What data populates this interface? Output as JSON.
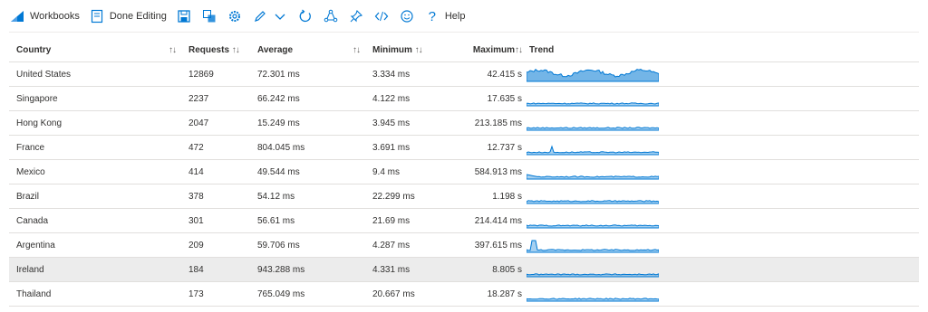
{
  "toolbar": {
    "workbooks_label": "Workbooks",
    "done_editing_label": "Done Editing",
    "help_label": "Help",
    "icons": [
      "save-icon",
      "clone-icon",
      "settings-icon",
      "edit-icon",
      "chevron-down-icon",
      "refresh-icon",
      "share-icon",
      "pin-icon",
      "code-icon",
      "smiley-icon",
      "help-icon"
    ],
    "accent": "#0078d4"
  },
  "table": {
    "columns": [
      "Country",
      "Requests",
      "Average",
      "Minimum",
      "Maximum",
      "Trend"
    ],
    "sort_glyph": "↑↓",
    "rows": [
      {
        "country": "United States",
        "requests": "12869",
        "average": "72.301 ms",
        "minimum": "3.334 ms",
        "maximum": "42.415 s"
      },
      {
        "country": "Singapore",
        "requests": "2237",
        "average": "66.242 ms",
        "minimum": "4.122 ms",
        "maximum": "17.635 s"
      },
      {
        "country": "Hong Kong",
        "requests": "2047",
        "average": "15.249 ms",
        "minimum": "3.945 ms",
        "maximum": "213.185 ms"
      },
      {
        "country": "France",
        "requests": "472",
        "average": "804.045 ms",
        "minimum": "3.691 ms",
        "maximum": "12.737 s"
      },
      {
        "country": "Mexico",
        "requests": "414",
        "average": "49.544 ms",
        "minimum": "9.4 ms",
        "maximum": "584.913 ms"
      },
      {
        "country": "Brazil",
        "requests": "378",
        "average": "54.12 ms",
        "minimum": "22.299 ms",
        "maximum": "1.198 s"
      },
      {
        "country": "Canada",
        "requests": "301",
        "average": "56.61 ms",
        "minimum": "21.69 ms",
        "maximum": "214.414 ms"
      },
      {
        "country": "Argentina",
        "requests": "209",
        "average": "59.706 ms",
        "minimum": "4.287 ms",
        "maximum": "397.615 ms"
      },
      {
        "country": "Ireland",
        "requests": "184",
        "average": "943.288 ms",
        "minimum": "4.331 ms",
        "maximum": "8.805 s"
      },
      {
        "country": "Thailand",
        "requests": "173",
        "average": "765.049 ms",
        "minimum": "20.667 ms",
        "maximum": "18.287 s"
      }
    ],
    "selected_row": 8,
    "trend_color": "#0078d4"
  }
}
